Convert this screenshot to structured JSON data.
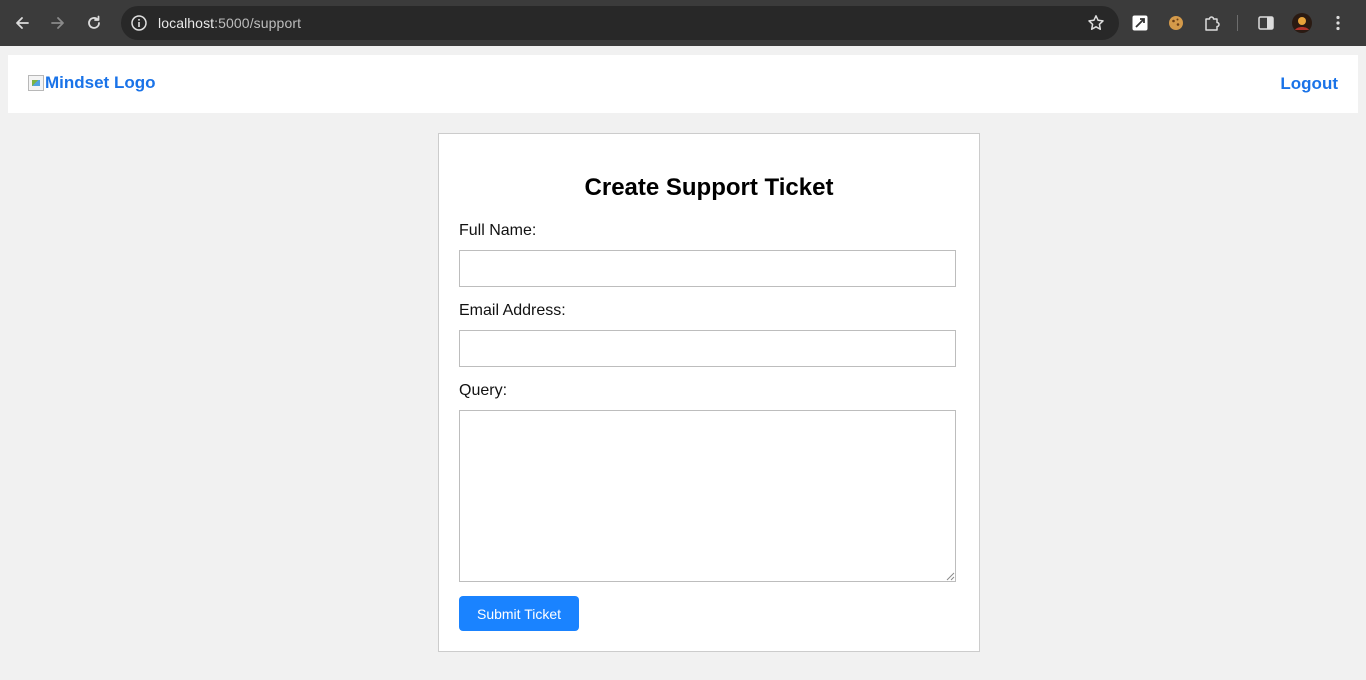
{
  "browser": {
    "url_host": "localhost",
    "url_path": ":5000/support",
    "back_icon": "back-arrow-icon",
    "forward_icon": "forward-arrow-icon",
    "reload_icon": "reload-icon"
  },
  "header": {
    "logo_alt": "Mindset Logo",
    "logout_label": "Logout",
    "link_color": "#1a73e8"
  },
  "form": {
    "title": "Create Support Ticket",
    "full_name_label": "Full Name:",
    "full_name_value": "",
    "email_label": "Email Address:",
    "email_value": "",
    "query_label": "Query:",
    "query_value": "",
    "submit_label": "Submit Ticket",
    "submit_color": "#1a83ff"
  }
}
